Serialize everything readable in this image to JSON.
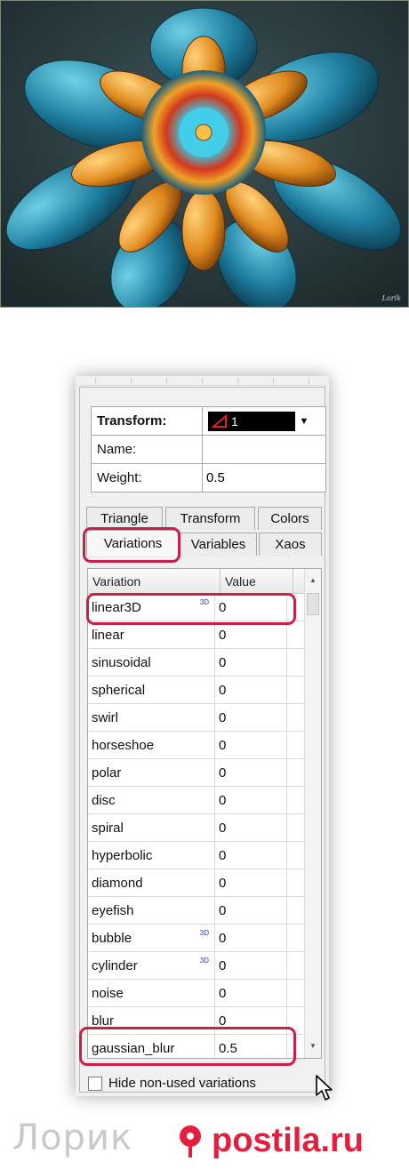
{
  "image": {
    "signature": "Lorik"
  },
  "transform_panel": {
    "transform_label": "Transform:",
    "transform_value": "1",
    "name_label": "Name:",
    "name_value": "",
    "weight_label": "Weight:",
    "weight_value": "0.5"
  },
  "tabs": {
    "row1": [
      "Triangle",
      "Transform",
      "Colors"
    ],
    "row2": [
      "Variations",
      "Variables",
      "Xaos"
    ],
    "active": "Variations"
  },
  "variations_table": {
    "columns": [
      "Variation",
      "Value"
    ],
    "rows": [
      {
        "name": "linear3D",
        "value": "0",
        "badge": "3D"
      },
      {
        "name": "linear",
        "value": "0",
        "badge": ""
      },
      {
        "name": "sinusoidal",
        "value": "0",
        "badge": ""
      },
      {
        "name": "spherical",
        "value": "0",
        "badge": ""
      },
      {
        "name": "swirl",
        "value": "0",
        "badge": ""
      },
      {
        "name": "horseshoe",
        "value": "0",
        "badge": ""
      },
      {
        "name": "polar",
        "value": "0",
        "badge": ""
      },
      {
        "name": "disc",
        "value": "0",
        "badge": ""
      },
      {
        "name": "spiral",
        "value": "0",
        "badge": ""
      },
      {
        "name": "hyperbolic",
        "value": "0",
        "badge": ""
      },
      {
        "name": "diamond",
        "value": "0",
        "badge": ""
      },
      {
        "name": "eyefish",
        "value": "0",
        "badge": ""
      },
      {
        "name": "bubble",
        "value": "0",
        "badge": "3D"
      },
      {
        "name": "cylinder",
        "value": "0",
        "badge": "3D"
      },
      {
        "name": "noise",
        "value": "0",
        "badge": ""
      },
      {
        "name": "blur",
        "value": "0",
        "badge": ""
      },
      {
        "name": "gaussian_blur",
        "value": "0.5",
        "badge": ""
      }
    ]
  },
  "hide_checkbox": {
    "label": "Hide non-used variations",
    "checked": false
  },
  "footer": {
    "left_logo": "Лорик",
    "right_logo": "postila.ru"
  },
  "colors": {
    "highlight": "#c8204a",
    "postila": "#e41e3c",
    "transform_combo_bg": "#000000"
  }
}
